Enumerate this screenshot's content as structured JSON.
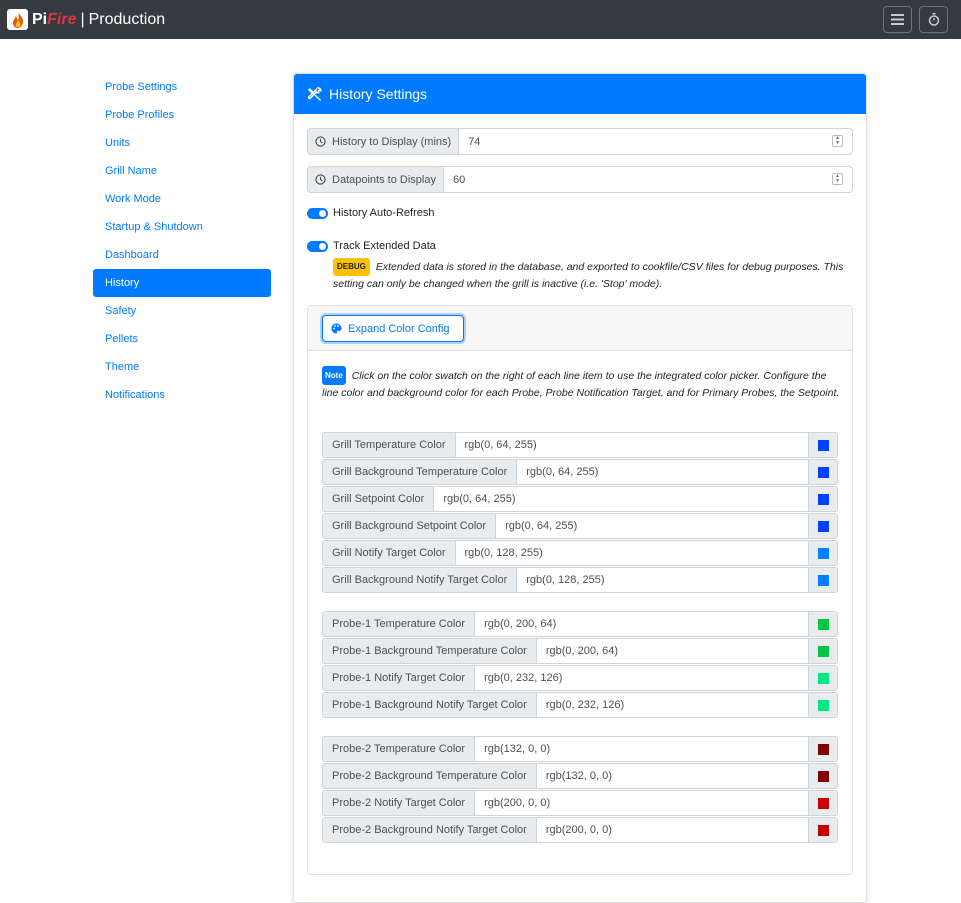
{
  "navbar": {
    "brand_pi": "Pi",
    "brand_fire": "Fire",
    "separator": "|",
    "name": "Production",
    "menu_icon": "hamburger-icon",
    "timer_icon": "stopwatch-icon"
  },
  "sidebar": {
    "items": [
      {
        "label": "Probe Settings",
        "active": false
      },
      {
        "label": "Probe Profiles",
        "active": false
      },
      {
        "label": "Units",
        "active": false
      },
      {
        "label": "Grill Name",
        "active": false
      },
      {
        "label": "Work Mode",
        "active": false
      },
      {
        "label": "Startup & Shutdown",
        "active": false
      },
      {
        "label": "Dashboard",
        "active": false
      },
      {
        "label": "History",
        "active": true
      },
      {
        "label": "Safety",
        "active": false
      },
      {
        "label": "Pellets",
        "active": false
      },
      {
        "label": "Theme",
        "active": false
      },
      {
        "label": "Notifications",
        "active": false
      }
    ]
  },
  "card": {
    "title": "History Settings",
    "history_display": {
      "label": "History to Display (mins)",
      "value": "74"
    },
    "datapoints_display": {
      "label": "Datapoints to Display",
      "value": "60"
    },
    "auto_refresh": {
      "label": "History Auto-Refresh",
      "on": true
    },
    "extended_data": {
      "label": "Track Extended Data",
      "on": true
    },
    "debug_badge": "DEBUG",
    "debug_text": "Extended data is stored in the database, and exported to cookfile/CSV files for debug purposes. This setting can only be changed when the grill is inactive (i.e. 'Stop' mode).",
    "expand_button": "Expand Color Config",
    "note_badge": "Note",
    "note_text": "Click on the color swatch on the right of each line item to use the integrated color picker. Configure the line color and background color for each Probe, Probe Notification Target, and for Primary Probes, the Setpoint."
  },
  "colors": [
    {
      "label": "Grill Temperature Color",
      "value": "rgb(0, 64, 255)",
      "swatch": "#0040ff"
    },
    {
      "label": "Grill Background Temperature Color",
      "value": "rgb(0, 64, 255)",
      "swatch": "#0040ff"
    },
    {
      "label": "Grill Setpoint Color",
      "value": "rgb(0, 64, 255)",
      "swatch": "#0040ff"
    },
    {
      "label": "Grill Background Setpoint Color",
      "value": "rgb(0, 64, 255)",
      "swatch": "#0040ff"
    },
    {
      "label": "Grill Notify Target Color",
      "value": "rgb(0, 128, 255)",
      "swatch": "#0080ff"
    },
    {
      "label": "Grill Background Notify Target Color",
      "value": "rgb(0, 128, 255)",
      "swatch": "#0080ff"
    },
    {
      "label": "Probe-1 Temperature Color",
      "value": "rgb(0, 200, 64)",
      "swatch": "#00c840"
    },
    {
      "label": "Probe-1 Background Temperature Color",
      "value": "rgb(0, 200, 64)",
      "swatch": "#00c840"
    },
    {
      "label": "Probe-1 Notify Target Color",
      "value": "rgb(0, 232, 126)",
      "swatch": "#00e87e"
    },
    {
      "label": "Probe-1 Background Notify Target Color",
      "value": "rgb(0, 232, 126)",
      "swatch": "#00e87e"
    },
    {
      "label": "Probe-2 Temperature Color",
      "value": "rgb(132, 0, 0)",
      "swatch": "#840000"
    },
    {
      "label": "Probe-2 Background Temperature Color",
      "value": "rgb(132, 0, 0)",
      "swatch": "#840000"
    },
    {
      "label": "Probe-2 Notify Target Color",
      "value": "rgb(200, 0, 0)",
      "swatch": "#c80000"
    },
    {
      "label": "Probe-2 Background Notify Target Color",
      "value": "rgb(200, 0, 0)",
      "swatch": "#c80000"
    }
  ]
}
